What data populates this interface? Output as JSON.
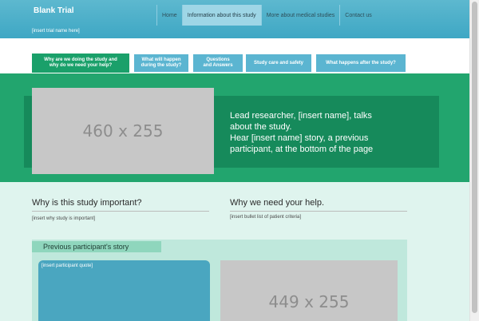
{
  "header": {
    "site_title": "Blank Trial",
    "trial_name": "[insert trial name here]",
    "nav": [
      {
        "label": "Home"
      },
      {
        "label": "Information about this study"
      },
      {
        "label": "More about medical studies"
      },
      {
        "label": "Contact us"
      }
    ],
    "active_nav": "Information about this study"
  },
  "tabs": [
    {
      "line1": "Why are we doing the study and",
      "line2": "why do we need your help?"
    },
    {
      "line1": "What will happen",
      "line2": "during the study?"
    },
    {
      "line1": "Questions",
      "line2": "and Answers"
    },
    {
      "line1": "Study care and safety",
      "line2": ""
    },
    {
      "line1": "What happens after the study?",
      "line2": ""
    }
  ],
  "hero": {
    "image_placeholder": "460 x 255",
    "text_lines": [
      "Lead researcher, [insert name], talks",
      "about the study.",
      "Hear [insert name] story, a previous",
      "participant, at the bottom of the page"
    ]
  },
  "sections": {
    "importance_heading": "Why is this study important?",
    "importance_text": "[insert why study is important]",
    "need_heading": "Why we need your help.",
    "need_text": "[insert bullet list of patient criteria]"
  },
  "story": {
    "label": "Previous participant's story",
    "quote": "[insert participant quote]",
    "image_placeholder": "449 x 255"
  },
  "colors": {
    "header": "#3ea7c4",
    "tab": "#5bb5d1",
    "active_tab": "#1aa06a",
    "hero": "#22a56e",
    "hero_dark": "#168a5b",
    "lower_bg": "#dff4ee",
    "story_bg": "#bfe8dc",
    "quote_box": "#4aa6c0",
    "placeholder": "#c7c7c7"
  }
}
